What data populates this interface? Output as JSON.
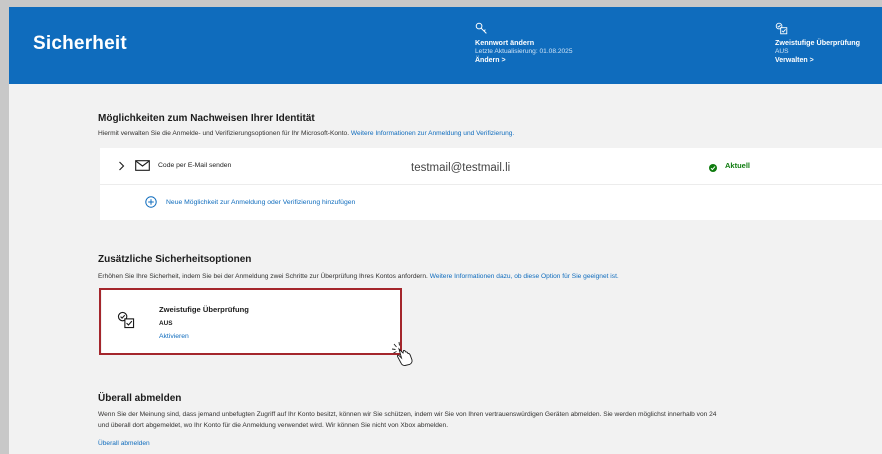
{
  "header": {
    "title": "Sicherheit",
    "password": {
      "icon": "key-icon",
      "title": "Kennwort ändern",
      "subtitle": "Letzte Aktualisierung: 01.08.2025",
      "link": "Ändern >"
    },
    "twofactor": {
      "icon": "two-step-icon",
      "title": "Zweistufige Überprüfung",
      "status": "AUS",
      "link": "Verwalten >"
    }
  },
  "identity": {
    "title": "Möglichkeiten zum Nachweisen Ihrer Identität",
    "desc_prefix": "Hiermit verwalten Sie die Anmelde- und Verifizierungsoptionen für Ihr Microsoft-Konto.",
    "desc_link": "Weitere Informationen zur Anmeldung und Verifizierung.",
    "method": {
      "label": "Code per E-Mail senden",
      "value": "testmail@testmail.li",
      "status": "Aktuell"
    },
    "add_label": "Neue Möglichkeit zur Anmeldung oder Verifizierung hinzufügen"
  },
  "additional": {
    "title": "Zusätzliche Sicherheitsoptionen",
    "desc_prefix": "Erhöhen Sie Ihre Sicherheit, indem Sie bei der Anmeldung zwei Schritte zur Überprüfung Ihres Kontos anfordern.",
    "desc_link": "Weitere Informationen dazu, ob diese Option für Sie geeignet ist.",
    "card": {
      "title": "Zweistufige Überprüfung",
      "status": "AUS",
      "action": "Aktivieren"
    }
  },
  "signout": {
    "title": "Überall abmelden",
    "desc_line1": "Wenn Sie der Meinung sind, dass jemand unbefugten Zugriff auf Ihr Konto besitzt, können wir Sie schützen, indem wir Sie von Ihren vertrauenswürdigen Geräten abmelden. Sie werden möglichst innerhalb von 24",
    "desc_line2": "und überall dort abgemeldet, wo Ihr Konto für die Anmeldung verwendet wird. Wir können Sie nicht von Xbox abmelden.",
    "link": "Überall abmelden"
  },
  "colors": {
    "brand": "#0f6cbd",
    "highlight": "#a4262c",
    "success": "#107c10"
  }
}
